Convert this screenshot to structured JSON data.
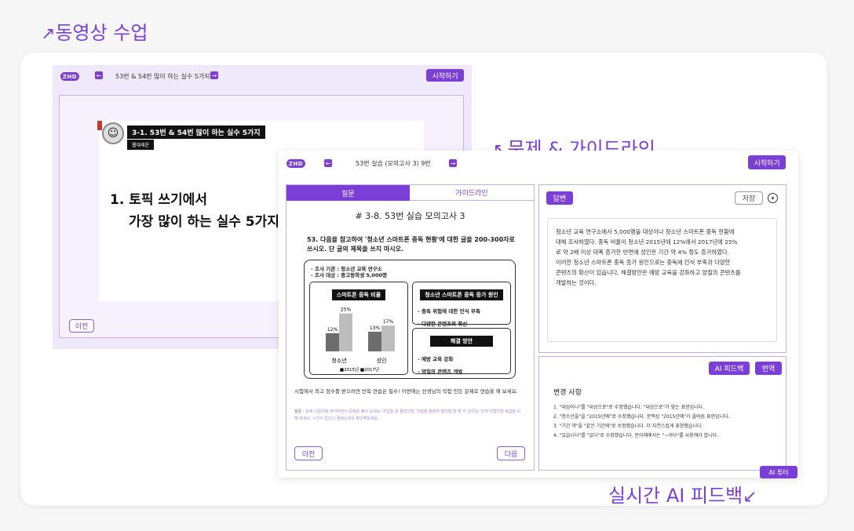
{
  "labels": {
    "video": "동영상 수업",
    "problem": "문제 & 가이드라인",
    "feedback": "실시간 AI 피드백"
  },
  "colors": {
    "accent": "#7b3fd6",
    "panel_border": "#c6aef0",
    "bar_dark": "#6d6d6d",
    "bar_light": "#bdbdbd"
  },
  "video": {
    "logo": "ZHD",
    "title": "53번 & 54번 많이 하는 실수 5가지",
    "start": "시작하기",
    "slide_heading": "3-1. 53번 & 54번 많이 하는 실수 5가지",
    "slide_tag": "웹대세윤",
    "slide_line1": "1. 토픽 쓰기에서",
    "slide_line2": "가장 많이 하는 실수 5가지",
    "prev": "이전"
  },
  "problem": {
    "logo": "ZHD",
    "title": "53번 실습 (모의고사 3) 9번",
    "start": "시작하기",
    "tab_question": "질문",
    "tab_guideline": "가이드라인",
    "heading": "# 3-8. 53번 실습 모의고사 3",
    "prompt": "53. 다음을 참고하여 '청소년 스마트폰 중독 현황'에 대한 글을 200-300자로 쓰시오. 단 글의 제목을 쓰지 마시오.",
    "survey_org": "- 조사 기관 : 청소년 교육 연구소",
    "survey_target": "- 조사 대상 : 중고등학생 5,000명",
    "chart_title": "스마트폰 중독 비율",
    "cause_title": "청소년 스마트폰 중독 증가 원인",
    "cause_items": [
      "- 중독 위험에 대한 인식 부족",
      "- 다양한 콘텐츠의 확산"
    ],
    "solution_title": "해결 방안",
    "solution_items": [
      "- 예방 교육 강화",
      "- 양질의 콘텐츠 개발"
    ],
    "note": "시험에서 최고 점수를 받으려면 반복 연습은 필수! 이번에는 선생님의 직접 만든 문제로 연습을 해 보세요.",
    "note2_prefix": "질문 :",
    "note2": "실제 시험처럼 생각하면서 문제를 풀어 보세요. 수업을 잘 들었다면, 연습을 충분히 했다면 잘 할 수 있어요. 만약 어렵다면 복습을 더 해 보세요. 시간이 없다나 결정는지도 확인해보세요.",
    "prev": "이전",
    "next": "다음",
    "answer_tab": "답변",
    "save": "저장",
    "answer_text": [
      "청소년 교육 연구소에서 5,000명을 대상이나 청소년 스마트폰 중독 현황에",
      "대해 조사하였다. 중독 비율이 청소년 2015년에 12%에서 2017년에 25%",
      "로 약 2배 이상 대폭 증가한 반면에 성인은 기간 약 4% 정도 증가하였다.",
      "이러한 청소년 스마트폰 중독 증가 원인으로는 중독에 인식 부족과 다양한",
      "콘텐츠의 확산이 있습니다. 해결방안은 예방 교육을 강화하고 양질의 콘텐츠를",
      "개발하는 것이다."
    ],
    "ai_feedback": "AI 피드백",
    "translate": "번역",
    "changes_title": "변경 사항",
    "changes": [
      "1. \"대상이나\"를 \"대상으로\"로 수정했습니다. \"대상으로\"가 맞는 표현입니다.",
      "2. \"청소년을\"을 \"2015년에\"로 수정했습니다. 문맥상 \"2015년에\"가 올바른 표현입니다.",
      "3. \"기간 약\"을 \"같은 기간에\"로 수정했습니다. 더 자연스럽게 표현했습니다.",
      "4. \"있습니다\"를 \"있다\"로 수정했습니다. 문어체에서는 \"~이다\"를 사용해야 합니다."
    ],
    "ai_tutor": "AI 튜터"
  },
  "chart_data": {
    "type": "bar",
    "title": "스마트폰 중독 비율",
    "categories": [
      "청소년",
      "성인"
    ],
    "series": [
      {
        "name": "2015년",
        "values": [
          12,
          13
        ]
      },
      {
        "name": "2017년",
        "values": [
          25,
          17
        ]
      }
    ],
    "data_labels": [
      "12%",
      "25%",
      "13%",
      "17%"
    ],
    "legend": [
      "■2015년",
      "■2017년"
    ],
    "ylim": [
      0,
      30
    ]
  }
}
